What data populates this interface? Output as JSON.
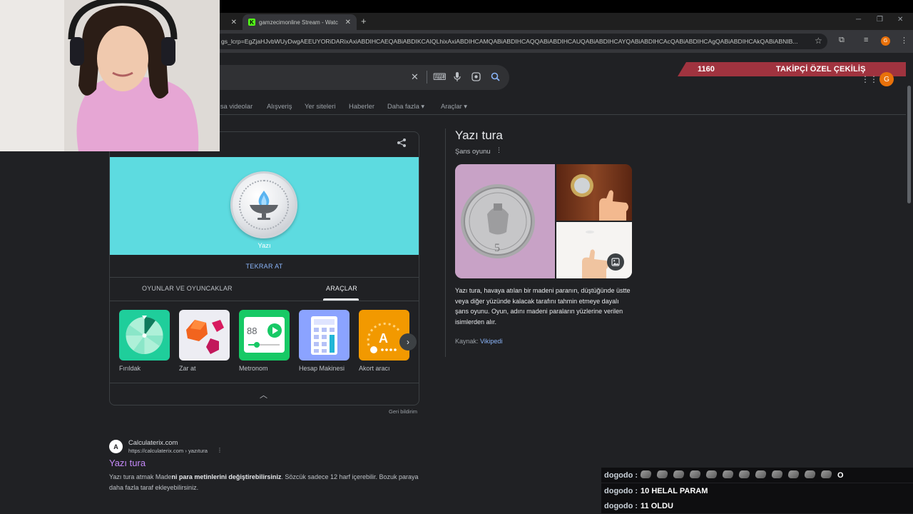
{
  "browser": {
    "tabs": [
      {
        "title": "",
        "close": "✕"
      },
      {
        "title": "gamzecimonline Stream - Watc",
        "close": "✕",
        "favicon": "K"
      }
    ],
    "new_tab": "+",
    "window_controls": [
      "─",
      "❐",
      "✕"
    ],
    "address": "gs_lcrp=EgZjaHJvbWUyDwgAEEUYORiDARixAxiABDIHCAEQABiABDIKCAIQLhixAxiABDIHCAMQABiABDIHCAQQABiABDIHCAUQABiABDIHCAYQABiABDIHCAcQABiABDIHCAgQABiABDIHCAkQABiABNIB...",
    "profile_initial": "G"
  },
  "search": {
    "clear_icon": "✕",
    "nav_tabs": [
      "Kısa videolar",
      "Alışveriş",
      "Yer siteleri",
      "Haberler",
      "Daha fazla ▾",
      "Araçlar ▾"
    ],
    "avatar_initial": "G"
  },
  "overlay": {
    "count": "1160",
    "label": "TAKİPÇİ ÖZEL ÇEKİLİŞ"
  },
  "widget": {
    "coin_result": "Yazı",
    "reroll": "TEKRAR AT",
    "categories": [
      "OYUNLAR VE OYUNCAKLAR",
      "ARAÇLAR"
    ],
    "selected_category": "ARAÇLAR",
    "tools": [
      {
        "label": "Fırıldak",
        "icon": "spinner-icon"
      },
      {
        "label": "Zar at",
        "icon": "dice-icon"
      },
      {
        "label": "Metronom",
        "icon": "metronome-icon",
        "value": "88"
      },
      {
        "label": "Hesap Makinesi",
        "icon": "calculator-icon"
      },
      {
        "label": "Akort aracı",
        "icon": "tuner-icon",
        "value": "A"
      }
    ],
    "feedback": "Geri bildirim",
    "colors": {
      "coin_bg": "#5ddbe0",
      "link": "#8ab4f8"
    }
  },
  "knowledge_panel": {
    "title": "Yazı tura",
    "subtitle": "Şans oyunu",
    "description": "Yazı tura, havaya atılan bir madeni paranın, düştüğünde üstte veya diğer yüzünde kalacak tarafını tahmin etmeye dayalı şans oyunu. Oyun, adını madeni paraların yüzlerine verilen isimlerden alır.",
    "source_label": "Kaynak:",
    "source_link": "Vikipedi"
  },
  "result": {
    "favicon": "A",
    "site": "Calculaterix.com",
    "url": "https://calculaterix.com › yazıtura",
    "title": "Yazı tura",
    "snippet_pre": "Yazı tura atmak Made",
    "snippet_bold": "ni para metinlerini değiştirebilirsiniz",
    "snippet_post": ". Sözcük sadece 12 harf içerebilir. Bozuk paraya daha fazla taraf ekleyebilirsiniz."
  },
  "chat": [
    {
      "user": "dogodo :",
      "message": "O",
      "emotes": 12
    },
    {
      "user": "dogodo :",
      "message": "10 HELAL PARAM"
    },
    {
      "user": "dogodo :",
      "message": "11 OLDU"
    }
  ]
}
